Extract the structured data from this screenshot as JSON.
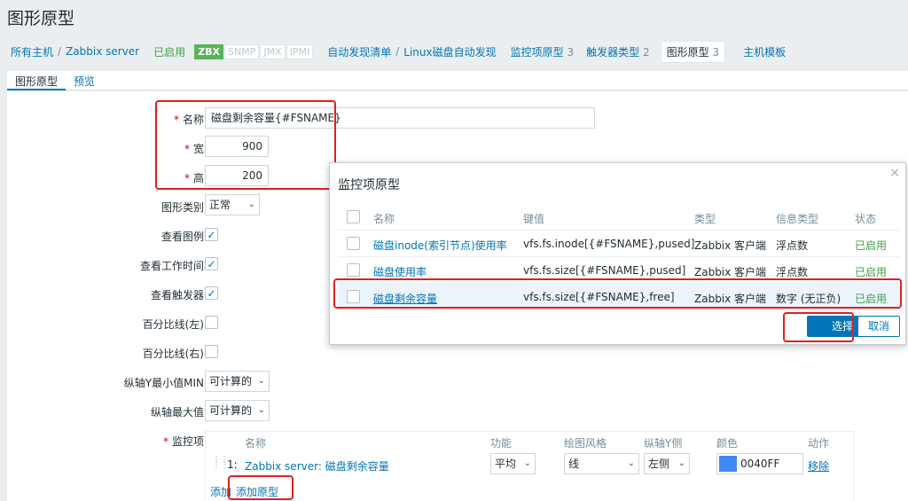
{
  "page": {
    "title": "图形原型"
  },
  "breadcrumbs": {
    "all_hosts": "所有主机",
    "sep": "/",
    "host": "Zabbix server",
    "enabled": "已启用",
    "badges": [
      "ZBX",
      "SNMP",
      "JMX",
      "IPMI"
    ],
    "discovery": "自动发现清单",
    "discovery_rule": "Linux磁盘自动发现",
    "item_prototypes": "监控项原型",
    "item_prototypes_count": "3",
    "trigger_prototypes": "触发器类型",
    "trigger_prototypes_count": "2",
    "graph_prototypes": "图形原型",
    "graph_prototypes_count": "3",
    "host_prototypes": "主机模板"
  },
  "tabs": {
    "graph_prototype": "图形原型",
    "preview": "预览"
  },
  "form": {
    "name_label": "名称",
    "name_value": "磁盘剩余容量{#FSNAME}",
    "width_label": "宽",
    "width_value": "900",
    "height_label": "高",
    "height_value": "200",
    "graph_type_label": "图形类别",
    "graph_type_value": "正常",
    "show_legend_label": "查看图例",
    "show_working_time_label": "查看工作时间",
    "show_triggers_label": "查看触发器",
    "percentile_left_label": "百分比线(左)",
    "percentile_right_label": "百分比线(右)",
    "ymin_label": "纵轴Y最小值MIN",
    "ymin_value": "可计算的",
    "ymax_label": "纵轴最大值",
    "ymax_value": "可计算的",
    "items_label": "监控项",
    "required_mark": "*"
  },
  "items_table": {
    "headers": {
      "name": "名称",
      "function": "功能",
      "draw_style": "绘图风格",
      "y_axis": "纵轴Y侧",
      "color": "颜色",
      "action": "动作"
    },
    "row": {
      "index": "1:",
      "name": "Zabbix server: 磁盘剩余容量",
      "function": "平均",
      "draw_style": "线",
      "y_axis": "左侧",
      "color": "0040FF",
      "action": "移除"
    },
    "add": "添加",
    "add_prototype": "添加原型"
  },
  "dialog": {
    "title": "监控项原型",
    "headers": {
      "name": "名称",
      "key": "键值",
      "type": "类型",
      "info_type": "信息类型",
      "status": "状态"
    },
    "rows": [
      {
        "name": "磁盘inode(索引节点)使用率",
        "key": "vfs.fs.inode[{#FSNAME},pused]",
        "type": "Zabbix 客户端",
        "info_type": "浮点数",
        "status": "已启用"
      },
      {
        "name": "磁盘使用率",
        "key": "vfs.fs.size[{#FSNAME},pused]",
        "type": "Zabbix 客户端",
        "info_type": "浮点数",
        "status": "已启用"
      },
      {
        "name": "磁盘剩余容量",
        "key": "vfs.fs.size[{#FSNAME},free]",
        "type": "Zabbix 客户端",
        "info_type": "数字 (无正负)",
        "status": "已启用"
      }
    ],
    "select_button": "选择",
    "cancel_button": "取消"
  },
  "colors": {
    "accent": "#0275b8",
    "enabled": "#429e47",
    "highlight": "#e41e1e",
    "series_color": "#4088f5"
  }
}
